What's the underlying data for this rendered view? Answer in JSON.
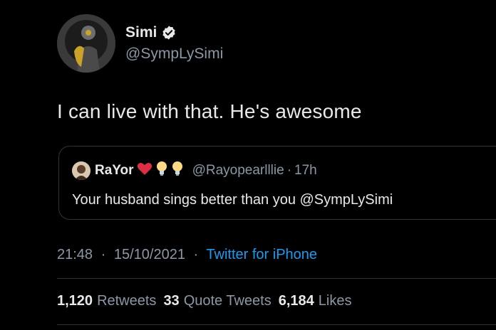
{
  "author": {
    "display_name": "Simi",
    "handle": "@SympLySimi",
    "verified": true,
    "avatar": "avatar-image"
  },
  "tweet": {
    "text": "I can live with that. He's awesome"
  },
  "quoted_tweet": {
    "display_name": "RaYor",
    "name_emojis": [
      "red-heart-emoji",
      "light-bulb-emoji",
      "light-bulb-emoji"
    ],
    "handle": "@Rayopearlllie",
    "separator": "·",
    "time": "17h",
    "text": "Your husband sings better than you @SympLySimi"
  },
  "meta": {
    "time": "21:48",
    "separator": "·",
    "date": "15/10/2021",
    "source": "Twitter for iPhone"
  },
  "stats": {
    "retweets_count": "1,120",
    "retweets_label": "Retweets",
    "quote_tweets_count": "33",
    "quote_tweets_label": "Quote Tweets",
    "likes_count": "6,184",
    "likes_label": "Likes"
  },
  "colors": {
    "background": "#000000",
    "text": "#e7e9ea",
    "secondary": "#8b98a5",
    "link": "#1d9bf0",
    "border": "#2f3336",
    "verified_badge": "#e7e9ea"
  }
}
